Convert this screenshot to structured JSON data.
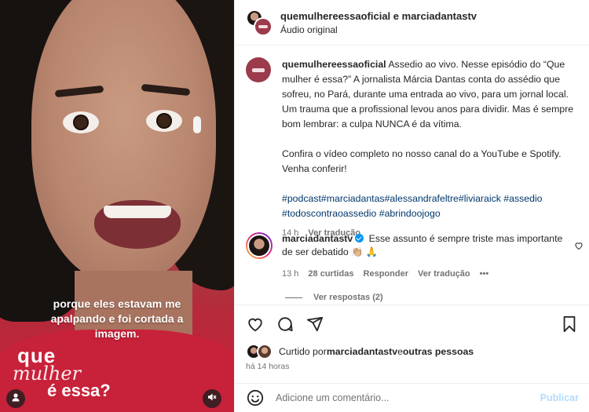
{
  "video": {
    "caption_lines": [
      "porque eles estavam me",
      "apalpando e foi cortada a",
      "imagem."
    ],
    "brand": {
      "line1": "que",
      "line2": "mulher",
      "line3": "é essa?"
    },
    "user_icon": "user-icon",
    "mute_icon": "speaker-muted-icon"
  },
  "header": {
    "user1": "quemulhereessaoficial",
    "conj": " e ",
    "user2": "marciadantastv",
    "audio": "Áudio original"
  },
  "caption": {
    "user": "quemulhereessaoficial",
    "text": "Assedio ao vivo. Nesse episódio do “Que mulher é essa?” A jornalista Márcia Dantas conta do assédio que sofreu, no Pará, durante uma entrada ao vivo, para um jornal local. Um trauma que a profissional levou anos para dividir. Mas é sempre bom lembrar: a culpa NUNCA é da vítima.",
    "paragraph2": "Confira o vídeo completo no nosso canal do a YouTube e Spotify. Venha conferir!",
    "hashtags": "#podcast#marciadantas#alessandrafeltre#liviaraick #assedio #todoscontraoassedio #abrindoojogo",
    "time": "14 h",
    "translate": "Ver tradução"
  },
  "comment": {
    "user": "marciadantastv",
    "text": "Esse assunto é sempre triste mas importante de ser debatido 👏🏼 🙏",
    "time": "13 h",
    "likes": "28 curtidas",
    "reply": "Responder",
    "translate": "Ver tradução",
    "more": "•••",
    "view_replies": "Ver respostas (2)"
  },
  "likes": {
    "prefix": "Curtido por ",
    "user": "marciadantastv",
    "suffix": " e ",
    "others": "outras pessoas"
  },
  "time_ago": "há 14 horas",
  "add_comment": {
    "placeholder": "Adicione um comentário...",
    "publish": "Publicar"
  }
}
